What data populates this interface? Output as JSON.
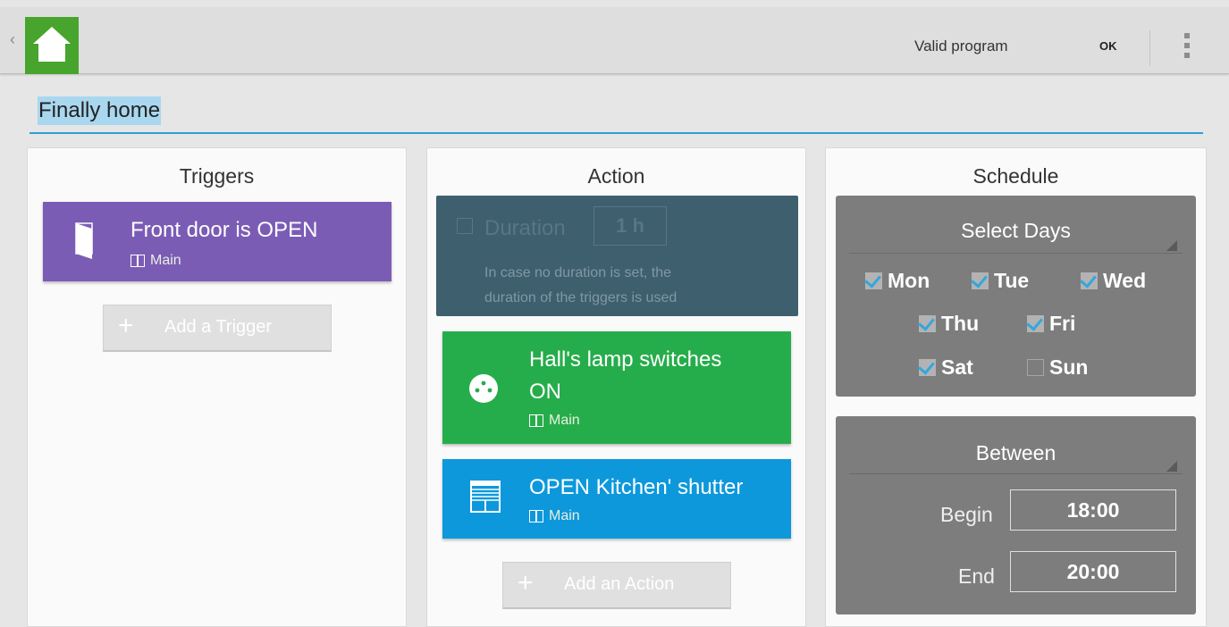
{
  "topbar": {
    "back_glyph": "‹",
    "status": "Valid program",
    "ok_label": "OK"
  },
  "program": {
    "name": "Finally home"
  },
  "triggers": {
    "heading": "Triggers",
    "items": [
      {
        "device": "Front door",
        "verb": " is OPEN",
        "room": "Main",
        "color": "#7b5cb5",
        "icon": "door-icon"
      }
    ],
    "add_label": "Add a Trigger"
  },
  "action": {
    "heading": "Action",
    "duration": {
      "label": "Duration",
      "value": "1 h",
      "hint_line1": "In case no duration is set, the",
      "hint_line2": "duration of the triggers is used",
      "color": "#3e5f6e"
    },
    "items": [
      {
        "device": "Hall's lamp",
        "verb": " switches",
        "line2": "ON",
        "room": "Main",
        "color": "#26ad4b",
        "icon": "plug-icon"
      },
      {
        "device": "OPEN Kitchen' shutter",
        "room": "Main",
        "color": "#0d98dc",
        "icon": "shutter-icon"
      }
    ],
    "add_label": "Add an Action"
  },
  "schedule": {
    "heading": "Schedule",
    "days_header": "Select Days",
    "days": [
      {
        "label": "Mon",
        "checked": true
      },
      {
        "label": "Tue",
        "checked": true
      },
      {
        "label": "Wed",
        "checked": true
      },
      {
        "label": "Thu",
        "checked": true
      },
      {
        "label": "Fri",
        "checked": true
      },
      {
        "label": "Sat",
        "checked": true
      },
      {
        "label": "Sun",
        "checked": false
      }
    ],
    "between_header": "Between",
    "begin_label": "Begin",
    "begin_value": "18:00",
    "end_label": "End",
    "end_value": "20:00"
  }
}
